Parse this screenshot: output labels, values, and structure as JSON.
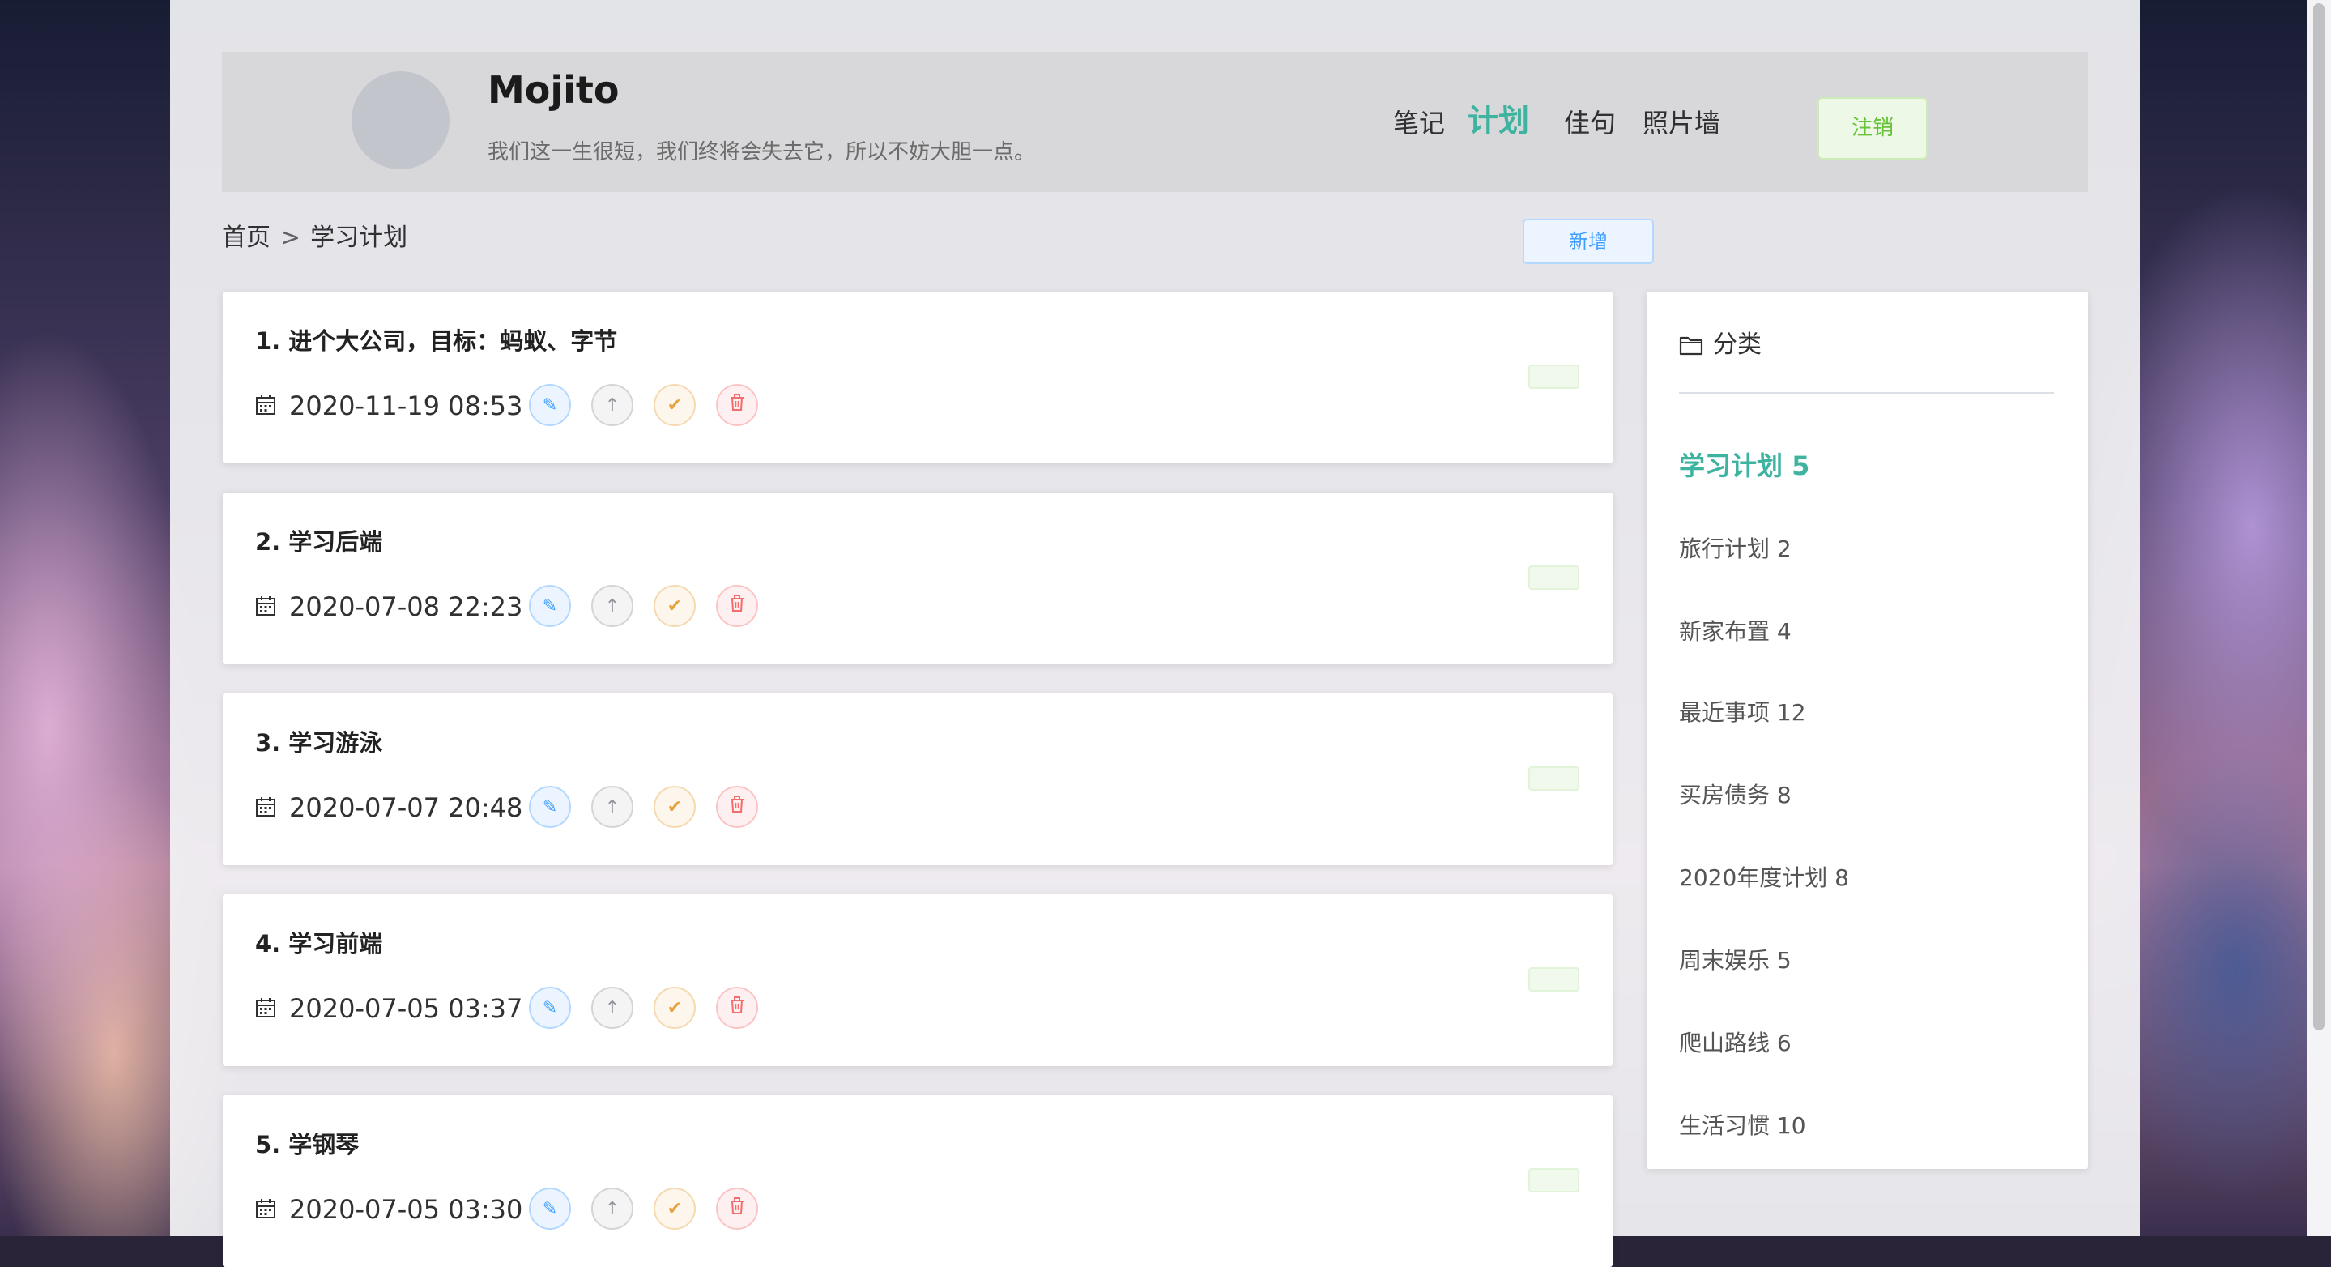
{
  "header": {
    "site_name": "Mojito",
    "motto": "我们这一生很短，我们终将会失去它，所以不妨大胆一点。",
    "nav": [
      {
        "label": "笔记",
        "active": false
      },
      {
        "label": "计划",
        "active": true
      },
      {
        "label": "佳句",
        "active": false
      },
      {
        "label": "照片墙",
        "active": false
      }
    ],
    "logout_label": "注销"
  },
  "breadcrumb": {
    "home": "首页",
    "current": "学习计划"
  },
  "add_label": "新增",
  "plans": [
    {
      "title": "1. 进个大公司，目标：蚂蚁、字节",
      "date": "2020-11-19 08:53"
    },
    {
      "title": "2. 学习后端",
      "date": "2020-07-08 22:23"
    },
    {
      "title": "3. 学习游泳",
      "date": "2020-07-07 20:48"
    },
    {
      "title": "4. 学习前端",
      "date": "2020-07-05 03:37"
    },
    {
      "title": "5. 学钢琴",
      "date": "2020-07-05 03:30"
    }
  ],
  "sidebar": {
    "title": "分类",
    "categories": [
      {
        "label": "学习计划 5",
        "active": true
      },
      {
        "label": "旅行计划 2",
        "active": false
      },
      {
        "label": "新家布置 4",
        "active": false
      },
      {
        "label": "最近事项 12",
        "active": false
      },
      {
        "label": "买房债务 8",
        "active": false
      },
      {
        "label": "2020年度计划 8",
        "active": false
      },
      {
        "label": "周末娱乐 5",
        "active": false
      },
      {
        "label": "爬山路线 6",
        "active": false
      },
      {
        "label": "生活习惯 10",
        "active": false
      }
    ]
  },
  "colors": {
    "accent": "#3db3a0",
    "edit": "#409eff",
    "done": "#e6a23c",
    "delete": "#f56c6c",
    "success": "#67c23a"
  }
}
